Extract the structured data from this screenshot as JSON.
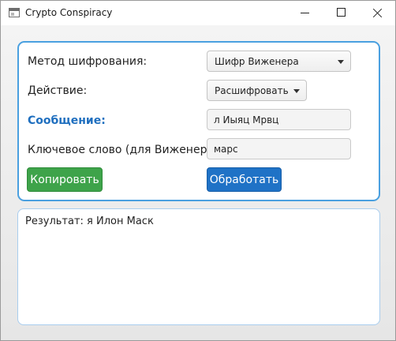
{
  "window": {
    "title": "Crypto Conspiracy"
  },
  "form": {
    "method_label": "Метод шифрования:",
    "method_value": "Шифр Виженера",
    "action_label": "Действие:",
    "action_value": "Расшифровать",
    "message_label": "Сообщение:",
    "message_value": "л Иыяц Мрвц",
    "keyword_label": "Ключевое слово (для Виженера):",
    "keyword_value": "марс",
    "copy_button": "Копировать",
    "process_button": "Обработать"
  },
  "result": {
    "text": "Результат: я Илон Маск"
  },
  "colors": {
    "accent_border": "#4aa0e0",
    "message_label": "#1f6fbf",
    "copy_button": "#3ea34a",
    "process_button": "#1f72c6"
  },
  "icons": {
    "app": "window-icon",
    "minimize": "minimize-icon",
    "maximize": "maximize-icon",
    "close": "close-icon",
    "dropdown": "chevron-down-icon"
  }
}
